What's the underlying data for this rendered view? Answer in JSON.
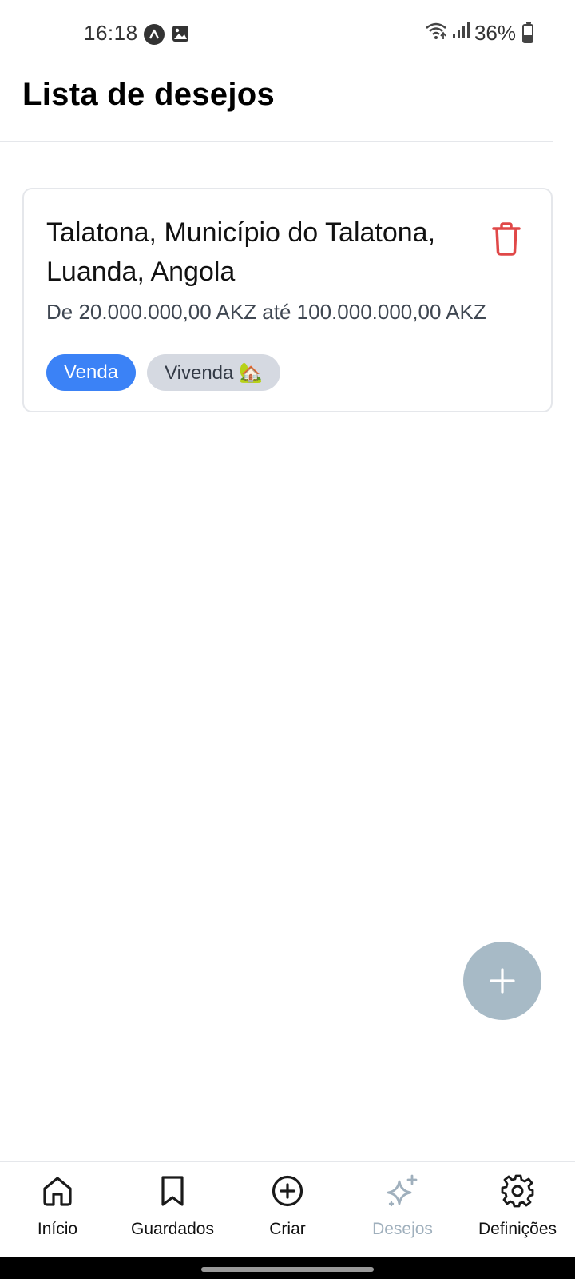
{
  "status_bar": {
    "time": "16:18",
    "battery": "36%",
    "battery_level": 0.36,
    "icons": [
      "notification-a-icon",
      "gallery-icon",
      "wifi-icon",
      "signal-icon",
      "battery-icon"
    ]
  },
  "header": {
    "title": "Lista de desejos"
  },
  "wishlist": {
    "items": [
      {
        "location": "Talatona, Município do Talatona, Luanda, Angola",
        "price_range": "De 20.000.000,00 AKZ até 100.000.000,00 AKZ",
        "tags": [
          "Venda",
          "Vivenda 🏡"
        ],
        "delete_icon": "trash-icon"
      }
    ]
  },
  "fab": {
    "icon": "plus-icon"
  },
  "bottom_nav": {
    "items": [
      {
        "label": "Início",
        "icon": "home-icon",
        "active": false
      },
      {
        "label": "Guardados",
        "icon": "bookmark-icon",
        "active": false
      },
      {
        "label": "Criar",
        "icon": "plus-circle-icon",
        "active": false
      },
      {
        "label": "Desejos",
        "icon": "sparkles-icon",
        "active": true
      },
      {
        "label": "Definições",
        "icon": "gear-icon",
        "active": false
      }
    ]
  },
  "colors": {
    "accent_blue": "#3b82f6",
    "danger_red": "#e04848",
    "fab_bg": "#a7bac6",
    "active_nav": "#a0b0bd"
  }
}
